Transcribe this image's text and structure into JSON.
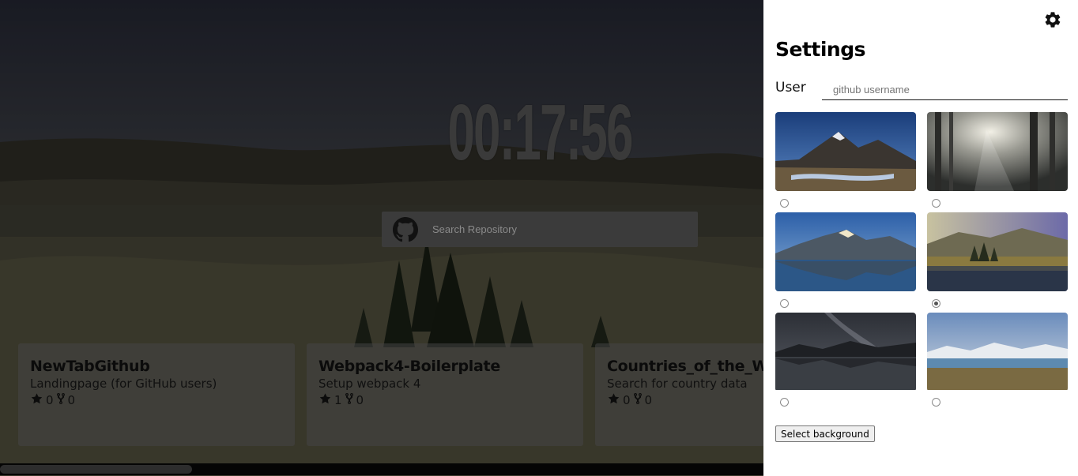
{
  "clock": {
    "time": "00:17:56"
  },
  "search": {
    "placeholder": "Search Repository"
  },
  "repos": [
    {
      "name": "NewTabGithub",
      "description": "Landingpage (for GitHub users)",
      "stars": "0",
      "forks": "0"
    },
    {
      "name": "Webpack4-Boilerplate",
      "description": "Setup webpack 4",
      "stars": "1",
      "forks": "0"
    },
    {
      "name": "Countries_of_the_World",
      "description": "Search for country data",
      "stars": "0",
      "forks": "0"
    }
  ],
  "settings": {
    "title": "Settings",
    "user_label": "User",
    "user_placeholder": "github username",
    "backgrounds": [
      {
        "scene": "mountain-stream-blue-sky",
        "selected": false
      },
      {
        "scene": "foggy-forest-sunbeams",
        "selected": false
      },
      {
        "scene": "alpine-lake-reflection",
        "selected": false
      },
      {
        "scene": "golden-lake-trees",
        "selected": true
      },
      {
        "scene": "milky-way-lake",
        "selected": false
      },
      {
        "scene": "snowy-mountains-lake",
        "selected": false
      }
    ],
    "select_button": "Select background"
  },
  "icons": {
    "settings": "gear-icon",
    "search": "github-icon",
    "star": "star-icon",
    "fork": "fork-icon"
  },
  "colors": {
    "panel_bg": "#ffffff",
    "card_bg": "#464646",
    "clock": "#3a3a3a"
  }
}
